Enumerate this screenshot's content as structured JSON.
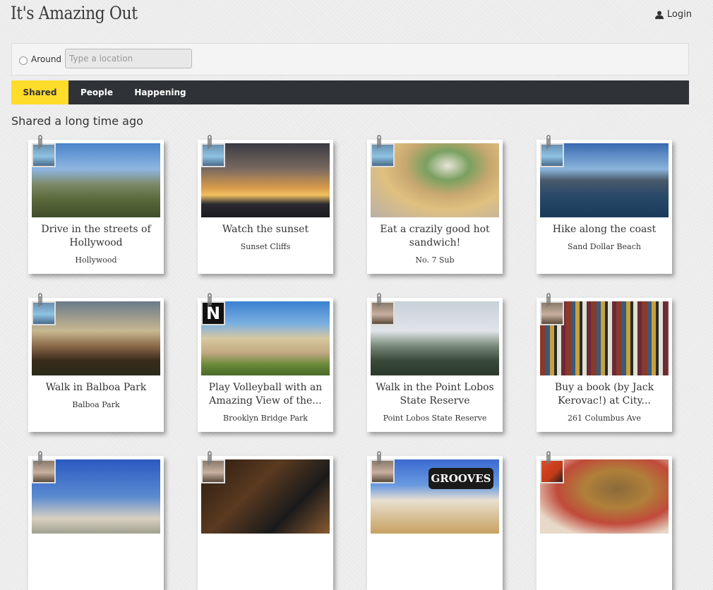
{
  "header": {
    "logo": "It's Amazing Out",
    "login": "Login"
  },
  "search": {
    "around_label": "Around",
    "placeholder": "Type a location"
  },
  "tabs": [
    {
      "label": "Shared",
      "active": true
    },
    {
      "label": "People",
      "active": false
    },
    {
      "label": "Happening",
      "active": false
    }
  ],
  "section_title": "Shared a long time ago",
  "cards": [
    {
      "title": "Drive in the streets of Hollywood",
      "place": "Hollywood"
    },
    {
      "title": "Watch the sunset",
      "place": "Sunset Cliffs"
    },
    {
      "title": "Eat a crazily good hot sandwich!",
      "place": "No. 7 Sub"
    },
    {
      "title": "Hike along the coast",
      "place": "Sand Dollar Beach"
    },
    {
      "title": "Walk in Balboa Park",
      "place": "Balboa Park"
    },
    {
      "title": "Play Volleyball with an Amazing View of the...",
      "place": "Brooklyn Bridge Park"
    },
    {
      "title": "Walk in the Point Lobos State Reserve",
      "place": "Point Lobos State Reserve"
    },
    {
      "title": "Buy a book (by Jack Kerovac!) at City...",
      "place": "261 Columbus Ave"
    }
  ],
  "icons": {
    "login": "user-icon",
    "clip": "paperclip-icon",
    "avatar": "avatar"
  },
  "colors": {
    "active_tab": "#fddc2a",
    "nav_bg": "#2f3236"
  },
  "image_labels": {
    "groove_sign": "GROOVES",
    "avatar_letter": "N"
  }
}
